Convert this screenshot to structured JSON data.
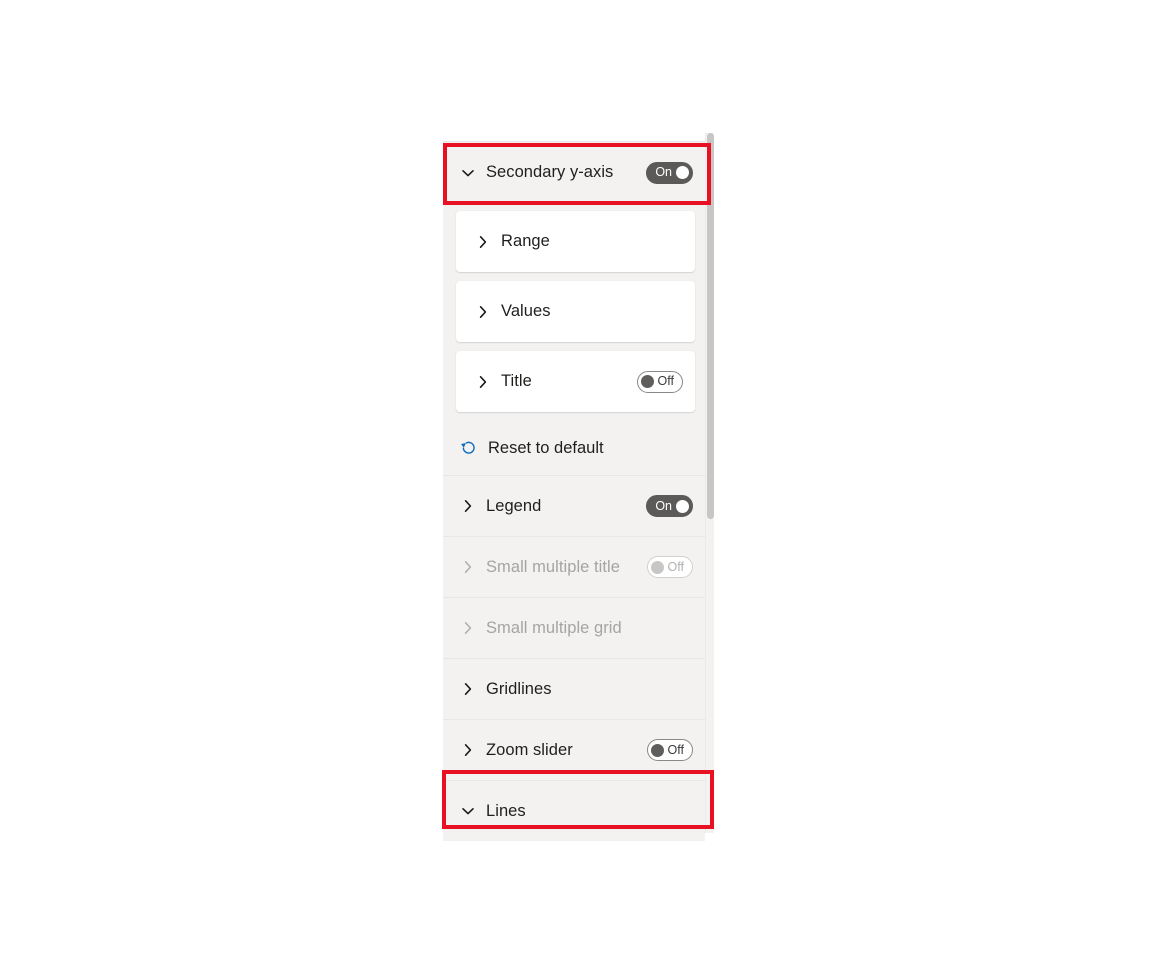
{
  "panel": {
    "name": "format-visual-pane",
    "background_color": "#f3f2f1",
    "highlight_color": "#e81123",
    "accent_color": "#0f6cbd"
  },
  "sections": {
    "secondary_y_axis": {
      "label": "Secondary y-axis",
      "chevron": "chevron-down-icon",
      "expanded": true,
      "toggle": {
        "state": "on",
        "label": "On"
      },
      "highlighted": true
    },
    "subcards": [
      {
        "label": "Range",
        "chevron": "chevron-right-icon",
        "toggle": null
      },
      {
        "label": "Values",
        "chevron": "chevron-right-icon",
        "toggle": null
      },
      {
        "label": "Title",
        "chevron": "chevron-right-icon",
        "toggle": {
          "state": "off",
          "label": "Off"
        }
      }
    ],
    "reset": {
      "label": "Reset to default",
      "icon": "reset-arrow-icon"
    },
    "rows": [
      {
        "label": "Legend",
        "chevron": "chevron-right-icon",
        "disabled": false,
        "toggle": {
          "state": "on",
          "label": "On"
        }
      },
      {
        "label": "Small multiple title",
        "chevron": "chevron-right-icon",
        "disabled": true,
        "toggle": {
          "state": "off",
          "label": "Off"
        }
      },
      {
        "label": "Small multiple grid",
        "chevron": "chevron-right-icon",
        "disabled": true,
        "toggle": null
      },
      {
        "label": "Gridlines",
        "chevron": "chevron-right-icon",
        "disabled": false,
        "toggle": null
      },
      {
        "label": "Zoom slider",
        "chevron": "chevron-right-icon",
        "disabled": false,
        "toggle": {
          "state": "off",
          "label": "Off"
        }
      }
    ],
    "lines": {
      "label": "Lines",
      "chevron": "chevron-down-icon",
      "expanded": true,
      "toggle": null,
      "highlighted": true
    }
  },
  "scrollbar": {
    "orientation": "vertical",
    "thumb_visible": true
  }
}
